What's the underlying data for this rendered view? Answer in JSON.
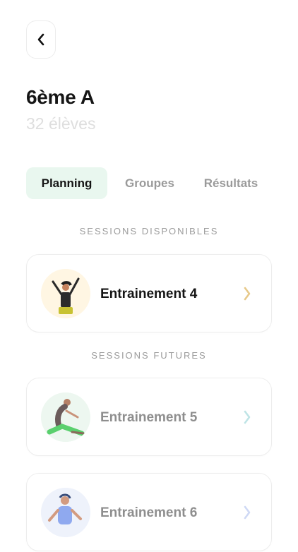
{
  "header": {
    "title": "6ème A",
    "subtitle": "32 élèves"
  },
  "tabs": [
    {
      "label": "Planning",
      "active": true
    },
    {
      "label": "Groupes",
      "active": false
    },
    {
      "label": "Résultats",
      "active": false
    }
  ],
  "sections": {
    "available": {
      "label": "SESSIONS DISPONIBLES"
    },
    "future": {
      "label": "SESSIONS FUTURES"
    }
  },
  "sessions": [
    {
      "label": "Entrainement 4",
      "icon": "woman-arms-raised-icon",
      "accent": "#e7c98a",
      "enabled": true
    },
    {
      "label": "Entrainement 5",
      "icon": "man-stretching-icon",
      "accent": "#bfe4e6",
      "enabled": false
    },
    {
      "label": "Entrainement 6",
      "icon": "boy-exercising-icon",
      "accent": "#cfd9f5",
      "enabled": false
    }
  ],
  "colors": {
    "tab_active_bg": "#e9f7ef",
    "muted_text": "#9b9b9b",
    "disabled_text": "#8e8e8e"
  }
}
